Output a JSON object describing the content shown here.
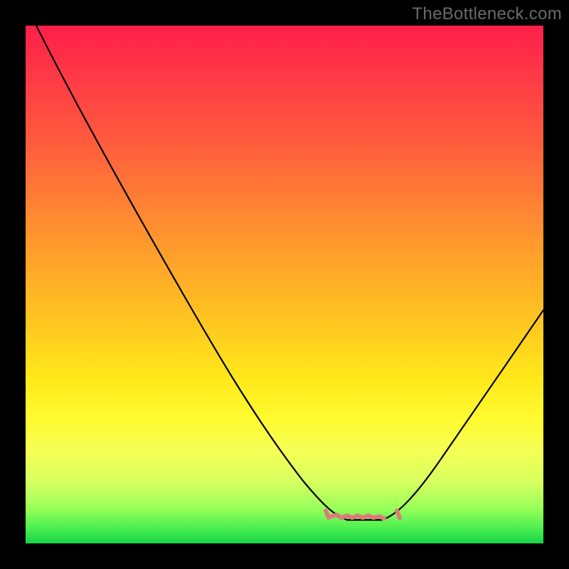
{
  "watermark": "TheBottleneck.com",
  "colors": {
    "background": "#000000",
    "gradient_top": "#ff1f4a",
    "gradient_bottom": "#18d44a",
    "curve": "#000000",
    "ticks": "#e07a7a",
    "watermark": "#6a6a6a"
  },
  "chart_data": {
    "type": "line",
    "title": "",
    "xlabel": "",
    "ylabel": "",
    "xlim": [
      0,
      100
    ],
    "ylim": [
      0,
      100
    ],
    "note": "Values estimated from pixel positions; y approximates a bottleneck % where 100=top(red) and 0=bottom(green). Curve descends from upper-left, reaches a flat minimum around x≈60–70, then rises toward the right.",
    "series": [
      {
        "name": "bottleneck-curve",
        "x": [
          2,
          6,
          10,
          15,
          20,
          25,
          30,
          35,
          40,
          45,
          50,
          55,
          58,
          60,
          63,
          66,
          69,
          72,
          75,
          80,
          85,
          90,
          95,
          100
        ],
        "y": [
          100,
          94,
          88,
          80,
          72,
          64,
          56,
          48,
          40,
          32,
          24,
          16,
          12,
          9,
          7,
          6,
          6,
          7,
          9,
          14,
          22,
          32,
          44,
          56
        ]
      }
    ],
    "flat_region": {
      "x_start": 60,
      "x_end": 72,
      "y": 6
    },
    "tick_marks": {
      "description": "short salmon ticks bracketing the flat minimum",
      "x": [
        58,
        60,
        62,
        64,
        66,
        68,
        70,
        72,
        74
      ],
      "y": 6
    }
  }
}
